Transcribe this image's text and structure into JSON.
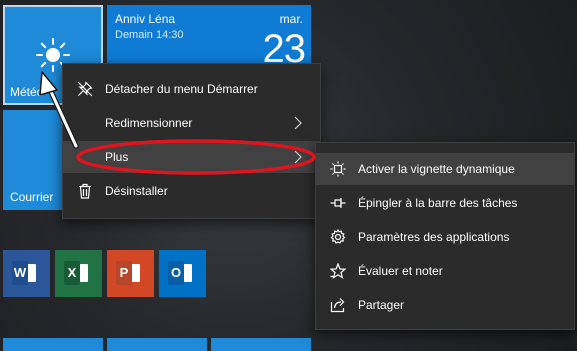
{
  "tiles": {
    "meteo_label": "Météo",
    "courrier_label": "Courrier",
    "calendar": {
      "event_title": "Anniv Léna",
      "event_time": "Demain 14:30",
      "day": "mar.",
      "date": "23"
    }
  },
  "context_menu": {
    "items": [
      {
        "label": "Détacher du menu Démarrer",
        "icon": "unpin-icon"
      },
      {
        "label": "Redimensionner",
        "icon": "",
        "submenu": true
      },
      {
        "label": "Plus",
        "icon": "",
        "submenu": true
      },
      {
        "label": "Désinstaller",
        "icon": "trash-icon"
      }
    ]
  },
  "submenu": {
    "items": [
      {
        "label": "Activer la vignette dynamique",
        "icon": "live-tile-icon"
      },
      {
        "label": "Épingler à la barre des tâches",
        "icon": "pin-icon"
      },
      {
        "label": "Paramètres des applications",
        "icon": "gear-icon"
      },
      {
        "label": "Évaluer et noter",
        "icon": "star-icon"
      },
      {
        "label": "Partager",
        "icon": "share-icon"
      }
    ]
  },
  "app_tiles": [
    {
      "name": "Word",
      "letter": "W",
      "color": "#2b579a"
    },
    {
      "name": "Excel",
      "letter": "X",
      "color": "#217346"
    },
    {
      "name": "PowerPoint",
      "letter": "P",
      "color": "#d24726"
    },
    {
      "name": "Outlook",
      "letter": "O",
      "color": "#0072c6"
    }
  ],
  "colors": {
    "tile_blue": "#1e8ad8",
    "menu_bg": "#2b2b2b",
    "menu_highlight": "#414141",
    "annotation_red": "#e0141e"
  }
}
